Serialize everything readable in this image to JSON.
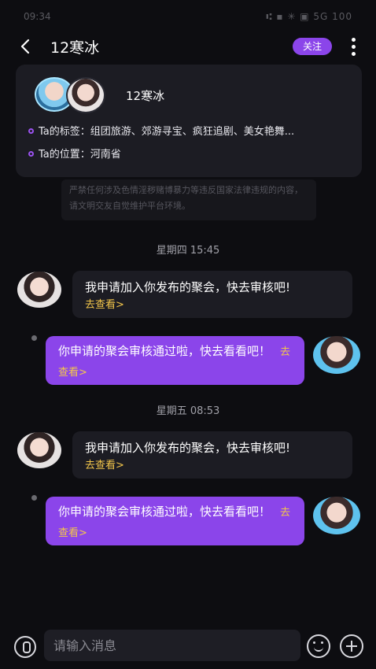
{
  "status_bar": {
    "time": "09:34",
    "indicators": "⑆ ▪ ✳ ▣ 5G 100"
  },
  "header": {
    "title": "12寒冰",
    "follow_label": "关注"
  },
  "profile": {
    "name": "12寒冰",
    "tags_label": "Ta的标签：",
    "tags_value": "组团旅游、郊游寻宝、疯狂追剧、美女艳舞...",
    "location_label": "Ta的位置：",
    "location_value": "河南省"
  },
  "notice": "严禁任何涉及色情淫秽赌博暴力等违反国家法律违规的内容，请文明交友自觉维护平台环境。",
  "messages": [
    {
      "timestamp": "星期四 15:45",
      "incoming_text": "我申请加入你发布的聚会，快去审核吧!",
      "incoming_link": "去查看>",
      "outgoing_text": "你申请的聚会审核通过啦，快去看看吧！",
      "outgoing_link": "去查看>"
    },
    {
      "timestamp": "星期五 08:53",
      "incoming_text": "我申请加入你发布的聚会，快去审核吧!",
      "incoming_link": "去查看>",
      "outgoing_text": "你申请的聚会审核通过啦，快去看看吧！",
      "outgoing_link": "去查看>"
    }
  ],
  "input": {
    "placeholder": "请输入消息"
  },
  "colors": {
    "accent": "#8b45ea",
    "link": "#f3c64b",
    "background": "#0d0d11",
    "card": "#1c1c23"
  }
}
